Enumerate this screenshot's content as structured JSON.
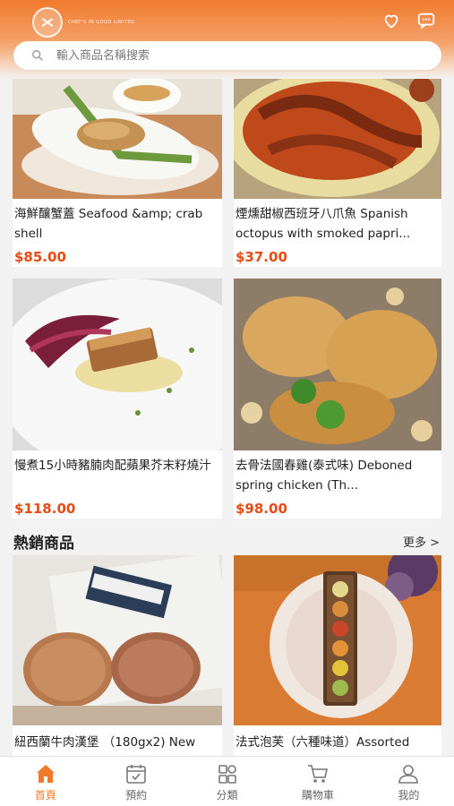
{
  "header": {
    "logo_text": "CHEF'S IN GOOD LIMITED",
    "favorites_icon": "heart-icon",
    "messages_icon": "chat-icon"
  },
  "search": {
    "placeholder": "輸入商品名稱搜索",
    "icon": "search-icon"
  },
  "products": [
    {
      "name": "海鮮釀蟹蓋 Seafood &amp; crab shell",
      "price": "$85.00"
    },
    {
      "name": "煙燻甜椒西班牙八爪魚 Spanish octopus with smoked papri...",
      "price": "$37.00"
    },
    {
      "name": "慢煮15小時豬腩肉配蘋果芥末籽燒汁",
      "price": "$118.00"
    },
    {
      "name": "去骨法國春雞(泰式味) Deboned spring chicken (Th...",
      "price": "$98.00"
    }
  ],
  "hot_section": {
    "title": "熱銷商品",
    "more_label": "更多 >",
    "items": [
      {
        "name": "紐西蘭牛肉漢堡 （180gx2) New"
      },
      {
        "name": "法式泡芙（六種味道）Assorted"
      }
    ]
  },
  "tabbar": {
    "items": [
      {
        "label": "首頁",
        "icon": "home-icon",
        "active": true
      },
      {
        "label": "預約",
        "icon": "calendar-check-icon",
        "active": false
      },
      {
        "label": "分類",
        "icon": "category-grid-icon",
        "active": false
      },
      {
        "label": "購物車",
        "icon": "cart-icon",
        "active": false
      },
      {
        "label": "我的",
        "icon": "user-icon",
        "active": false
      }
    ]
  },
  "colors": {
    "accent": "#ee7a2a",
    "price": "#e84a14"
  }
}
